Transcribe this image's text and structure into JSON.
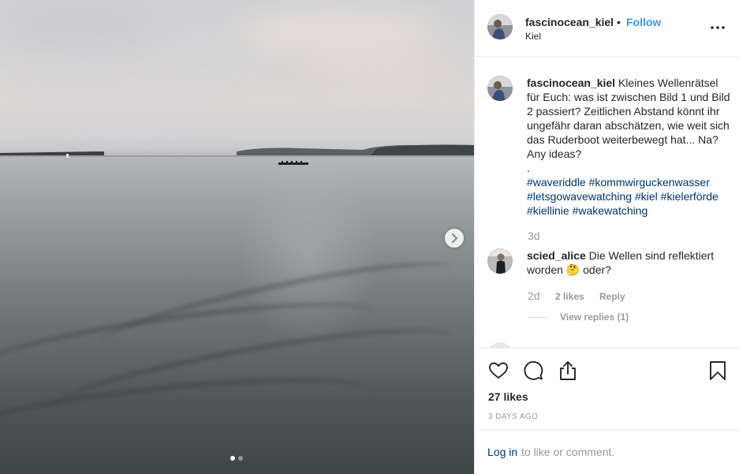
{
  "post": {
    "username": "fascinocean_kiel",
    "separator": "•",
    "follow_label": "Follow",
    "location": "Kiel"
  },
  "caption": {
    "username": "fascinocean_kiel",
    "text": "Kleines Wellenrätsel für Euch: was ist zwischen Bild 1 und Bild 2 passiert? Zeitlichen Abstand könnt ihr ungefähr daran abschätzen, wie weit sich das Ruderboot weiterbewegt hat... Na? Any ideas?",
    "dot": ".",
    "hashtags": [
      "#waveriddle",
      "#kommwirguckenwasser",
      "#letsgowavewatching",
      "#kiel",
      "#kielerförde",
      "#kiellinie",
      "#wakewatching"
    ],
    "age": "3d"
  },
  "comments": [
    {
      "username": "scied_alice",
      "text": "Die Wellen sind reflektiert worden",
      "emoji": "🤔",
      "text_after": "oder?",
      "age": "2d",
      "likes": "2 likes",
      "reply_label": "Reply",
      "view_replies": "View replies (1)"
    }
  ],
  "actions": {
    "likes_count": "27 likes",
    "date": "3 DAYS AGO"
  },
  "login": {
    "link": "Log in",
    "rest": "to like or comment."
  },
  "carousel": {
    "current": 1,
    "total": 2
  },
  "icons": {
    "more": "more-options-icon",
    "like": "heart-icon",
    "comment": "comment-icon",
    "share": "share-icon",
    "save": "bookmark-icon",
    "next": "chevron-right-icon"
  },
  "colors": {
    "link_blue": "#3897f0",
    "hashtag_blue": "#003569",
    "muted": "#999999",
    "text": "#262626"
  }
}
